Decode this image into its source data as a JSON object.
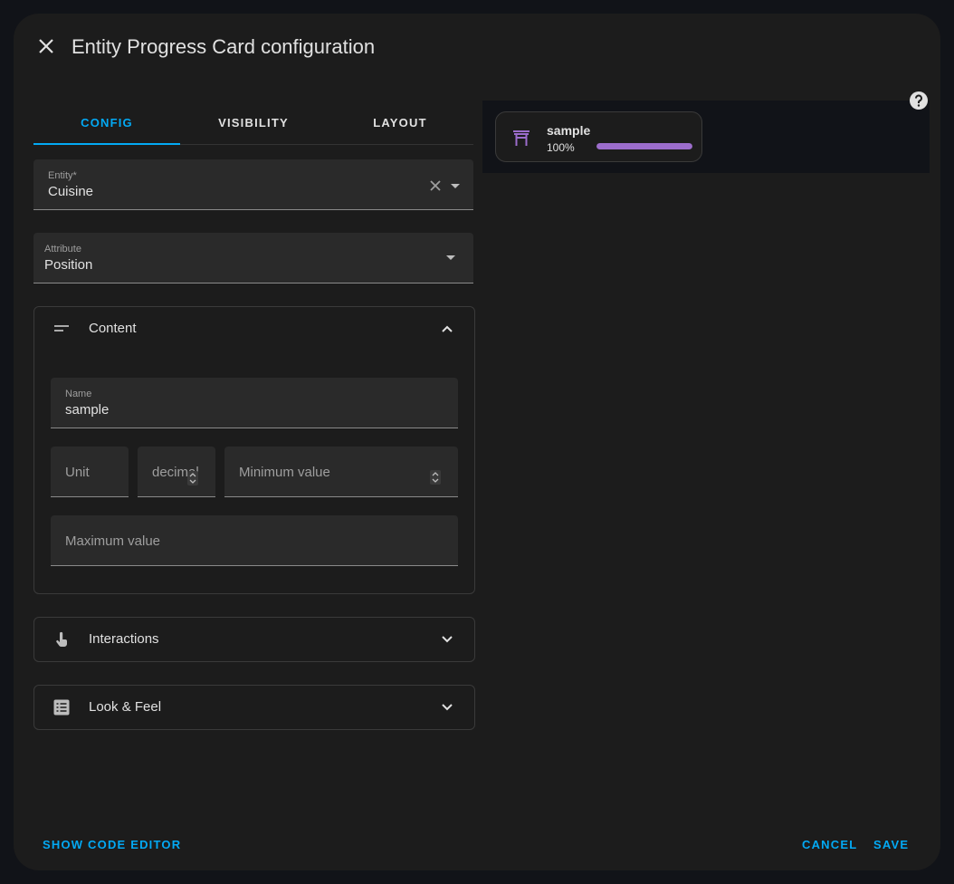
{
  "dialog": {
    "title": "Entity Progress Card configuration"
  },
  "tabs": [
    {
      "label": "CONFIG",
      "active": true
    },
    {
      "label": "VISIBILITY",
      "active": false
    },
    {
      "label": "LAYOUT",
      "active": false
    }
  ],
  "entity_field": {
    "label": "Entity*",
    "value": "Cuisine"
  },
  "attribute_field": {
    "label": "Attribute",
    "value": "Position"
  },
  "content_panel": {
    "title": "Content",
    "icon": "text-short-icon",
    "name_field": {
      "label": "Name",
      "value": "sample"
    },
    "unit_field": {
      "placeholder": "Unit"
    },
    "decimal_field": {
      "placeholder": "decimal"
    },
    "min_field": {
      "placeholder": "Minimum value"
    },
    "max_field": {
      "placeholder": "Maximum value"
    }
  },
  "interactions_panel": {
    "title": "Interactions",
    "icon": "gesture-tap-icon"
  },
  "look_panel": {
    "title": "Look & Feel",
    "icon": "list-box-icon"
  },
  "preview_card": {
    "name": "sample",
    "percent_label": "100%",
    "progress": 1.0,
    "icon": "gate-icon",
    "bar_color": "#9c6dcc",
    "icon_color": "#9c6dcc"
  },
  "footer": {
    "code_editor_label": "SHOW CODE EDITOR",
    "cancel_label": "CANCEL",
    "save_label": "SAVE"
  },
  "colors": {
    "accent": "#03a9f4",
    "background": "#1c1c1c",
    "field_bg": "#2a2a2a"
  }
}
